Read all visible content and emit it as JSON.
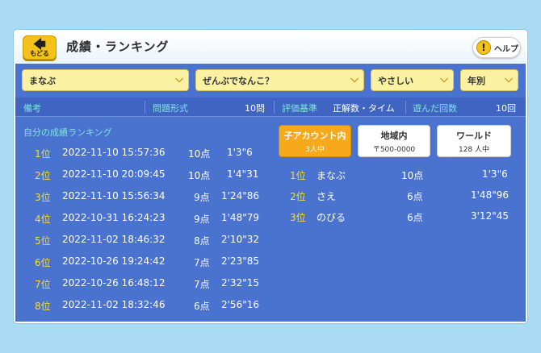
{
  "header": {
    "back_label": "もどる",
    "title": "成績・ランキング",
    "help_label": "ヘルプ",
    "help_icon_text": "!"
  },
  "filters": {
    "mode": "まなぶ",
    "question_count": "ぜんぶでなんこ？",
    "difficulty": "やさしい",
    "period": "年別"
  },
  "info": {
    "remarks_label": "備考",
    "format_label": "問題形式",
    "format_value": "10問",
    "criteria_label": "評価基準",
    "criteria_value": "正解数・タイム",
    "plays_label": "遊んだ回数",
    "plays_value": "10回"
  },
  "my_ranking": {
    "title": "自分の成績ランキング",
    "rows": [
      {
        "rank": "1位",
        "datetime": "2022-11-10 15:57:36",
        "score": "10点",
        "time": "1'3\"6"
      },
      {
        "rank": "2位",
        "datetime": "2022-11-10 20:09:45",
        "score": "10点",
        "time": "1'4\"31"
      },
      {
        "rank": "3位",
        "datetime": "2022-11-10 15:56:34",
        "score": "9点",
        "time": "1'24\"86"
      },
      {
        "rank": "4位",
        "datetime": "2022-10-31 16:24:23",
        "score": "9点",
        "time": "1'48\"79"
      },
      {
        "rank": "5位",
        "datetime": "2022-11-02 18:46:32",
        "score": "8点",
        "time": "2'10\"32"
      },
      {
        "rank": "6位",
        "datetime": "2022-10-26 19:24:42",
        "score": "7点",
        "time": "2'23\"85"
      },
      {
        "rank": "7位",
        "datetime": "2022-10-26 16:48:12",
        "score": "7点",
        "time": "2'32\"15"
      },
      {
        "rank": "8位",
        "datetime": "2022-11-02 18:32:46",
        "score": "6点",
        "time": "2'56\"16"
      }
    ]
  },
  "tabs": [
    {
      "label": "子アカウント内",
      "sub": "3人中",
      "active": true
    },
    {
      "label": "地域内",
      "sub": "〒500-0000",
      "active": false
    },
    {
      "label": "ワールド",
      "sub": "128 人中",
      "active": false
    }
  ],
  "leaderboard": {
    "rows": [
      {
        "rank": "1位",
        "name": "まなぶ",
        "score": "10点",
        "time": "1'3\"6"
      },
      {
        "rank": "2位",
        "name": "さえ",
        "score": "6点",
        "time": "1'48\"96"
      },
      {
        "rank": "3位",
        "name": "のびる",
        "score": "6点",
        "time": "3'12\"45"
      }
    ]
  },
  "colors": {
    "background": "#a9dcf3",
    "panel": "#4a72cf",
    "accent_yellow": "#f5c21b",
    "rank_yellow": "#f6df34",
    "label_cyan": "#7fe3e3",
    "active_tab": "#f6a91b"
  }
}
